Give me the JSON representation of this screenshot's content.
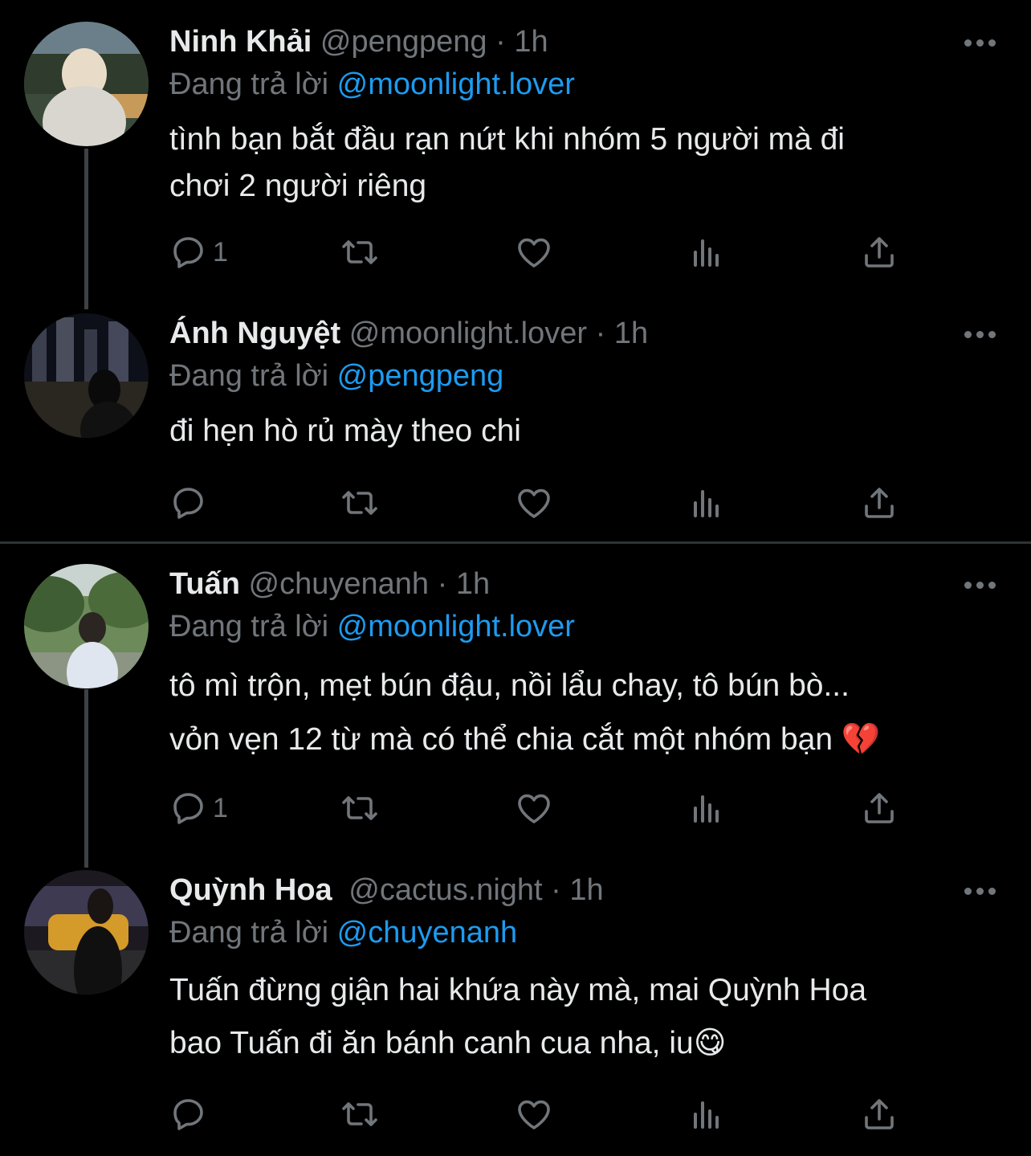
{
  "tweets": [
    {
      "name": "Ninh Khải",
      "handle": "@pengpeng",
      "dot": "·",
      "time": "1h",
      "replying_label": "Đang trả lời",
      "replying_to": "@moonlight.lover",
      "text_lines": [
        "tình bạn bắt đầu rạn nứt khi nhóm 5 người mà đi",
        "chơi 2 người riêng"
      ],
      "reply_count": "1"
    },
    {
      "name": "Ánh Nguyệt",
      "handle": "@moonlight.lover",
      "dot": "·",
      "time": "1h",
      "replying_label": "Đang trả lời",
      "replying_to": "@pengpeng",
      "text_lines": [
        "đi hẹn hò rủ mày theo chi"
      ],
      "reply_count": ""
    },
    {
      "name": "Tuấn",
      "handle": "@chuyenanh",
      "dot": "·",
      "time": "1h",
      "replying_label": "Đang trả lời",
      "replying_to": "@moonlight.lover",
      "text_lines": [
        "tô mì trộn, mẹt bún đậu, nồi lẩu chay, tô bún bò...",
        "vỏn vẹn 12 từ mà có thể chia cắt một nhóm bạn 💔"
      ],
      "reply_count": "1"
    },
    {
      "name": "Quỳnh Hoa",
      "handle": "@cactus.night",
      "dot": "·",
      "time": "1h",
      "replying_label": "Đang trả lời",
      "replying_to": "@chuyenanh",
      "text_lines": [
        "Tuấn đừng giận hai khứa này mà, mai Quỳnh Hoa",
        "bao Tuấn đi ăn bánh canh cua nha, iu😋"
      ],
      "reply_count": ""
    }
  ],
  "icons": {
    "reply": "reply-icon",
    "retweet": "retweet-icon",
    "like": "heart-icon",
    "views": "views-icon",
    "share": "share-icon",
    "more": "more-icon"
  },
  "colors": {
    "background": "#000000",
    "name": "#e7e9ea",
    "secondary": "#71767b",
    "mention": "#1d9bf0",
    "thread_line": "#3e4144",
    "divider": "#2f3336"
  }
}
